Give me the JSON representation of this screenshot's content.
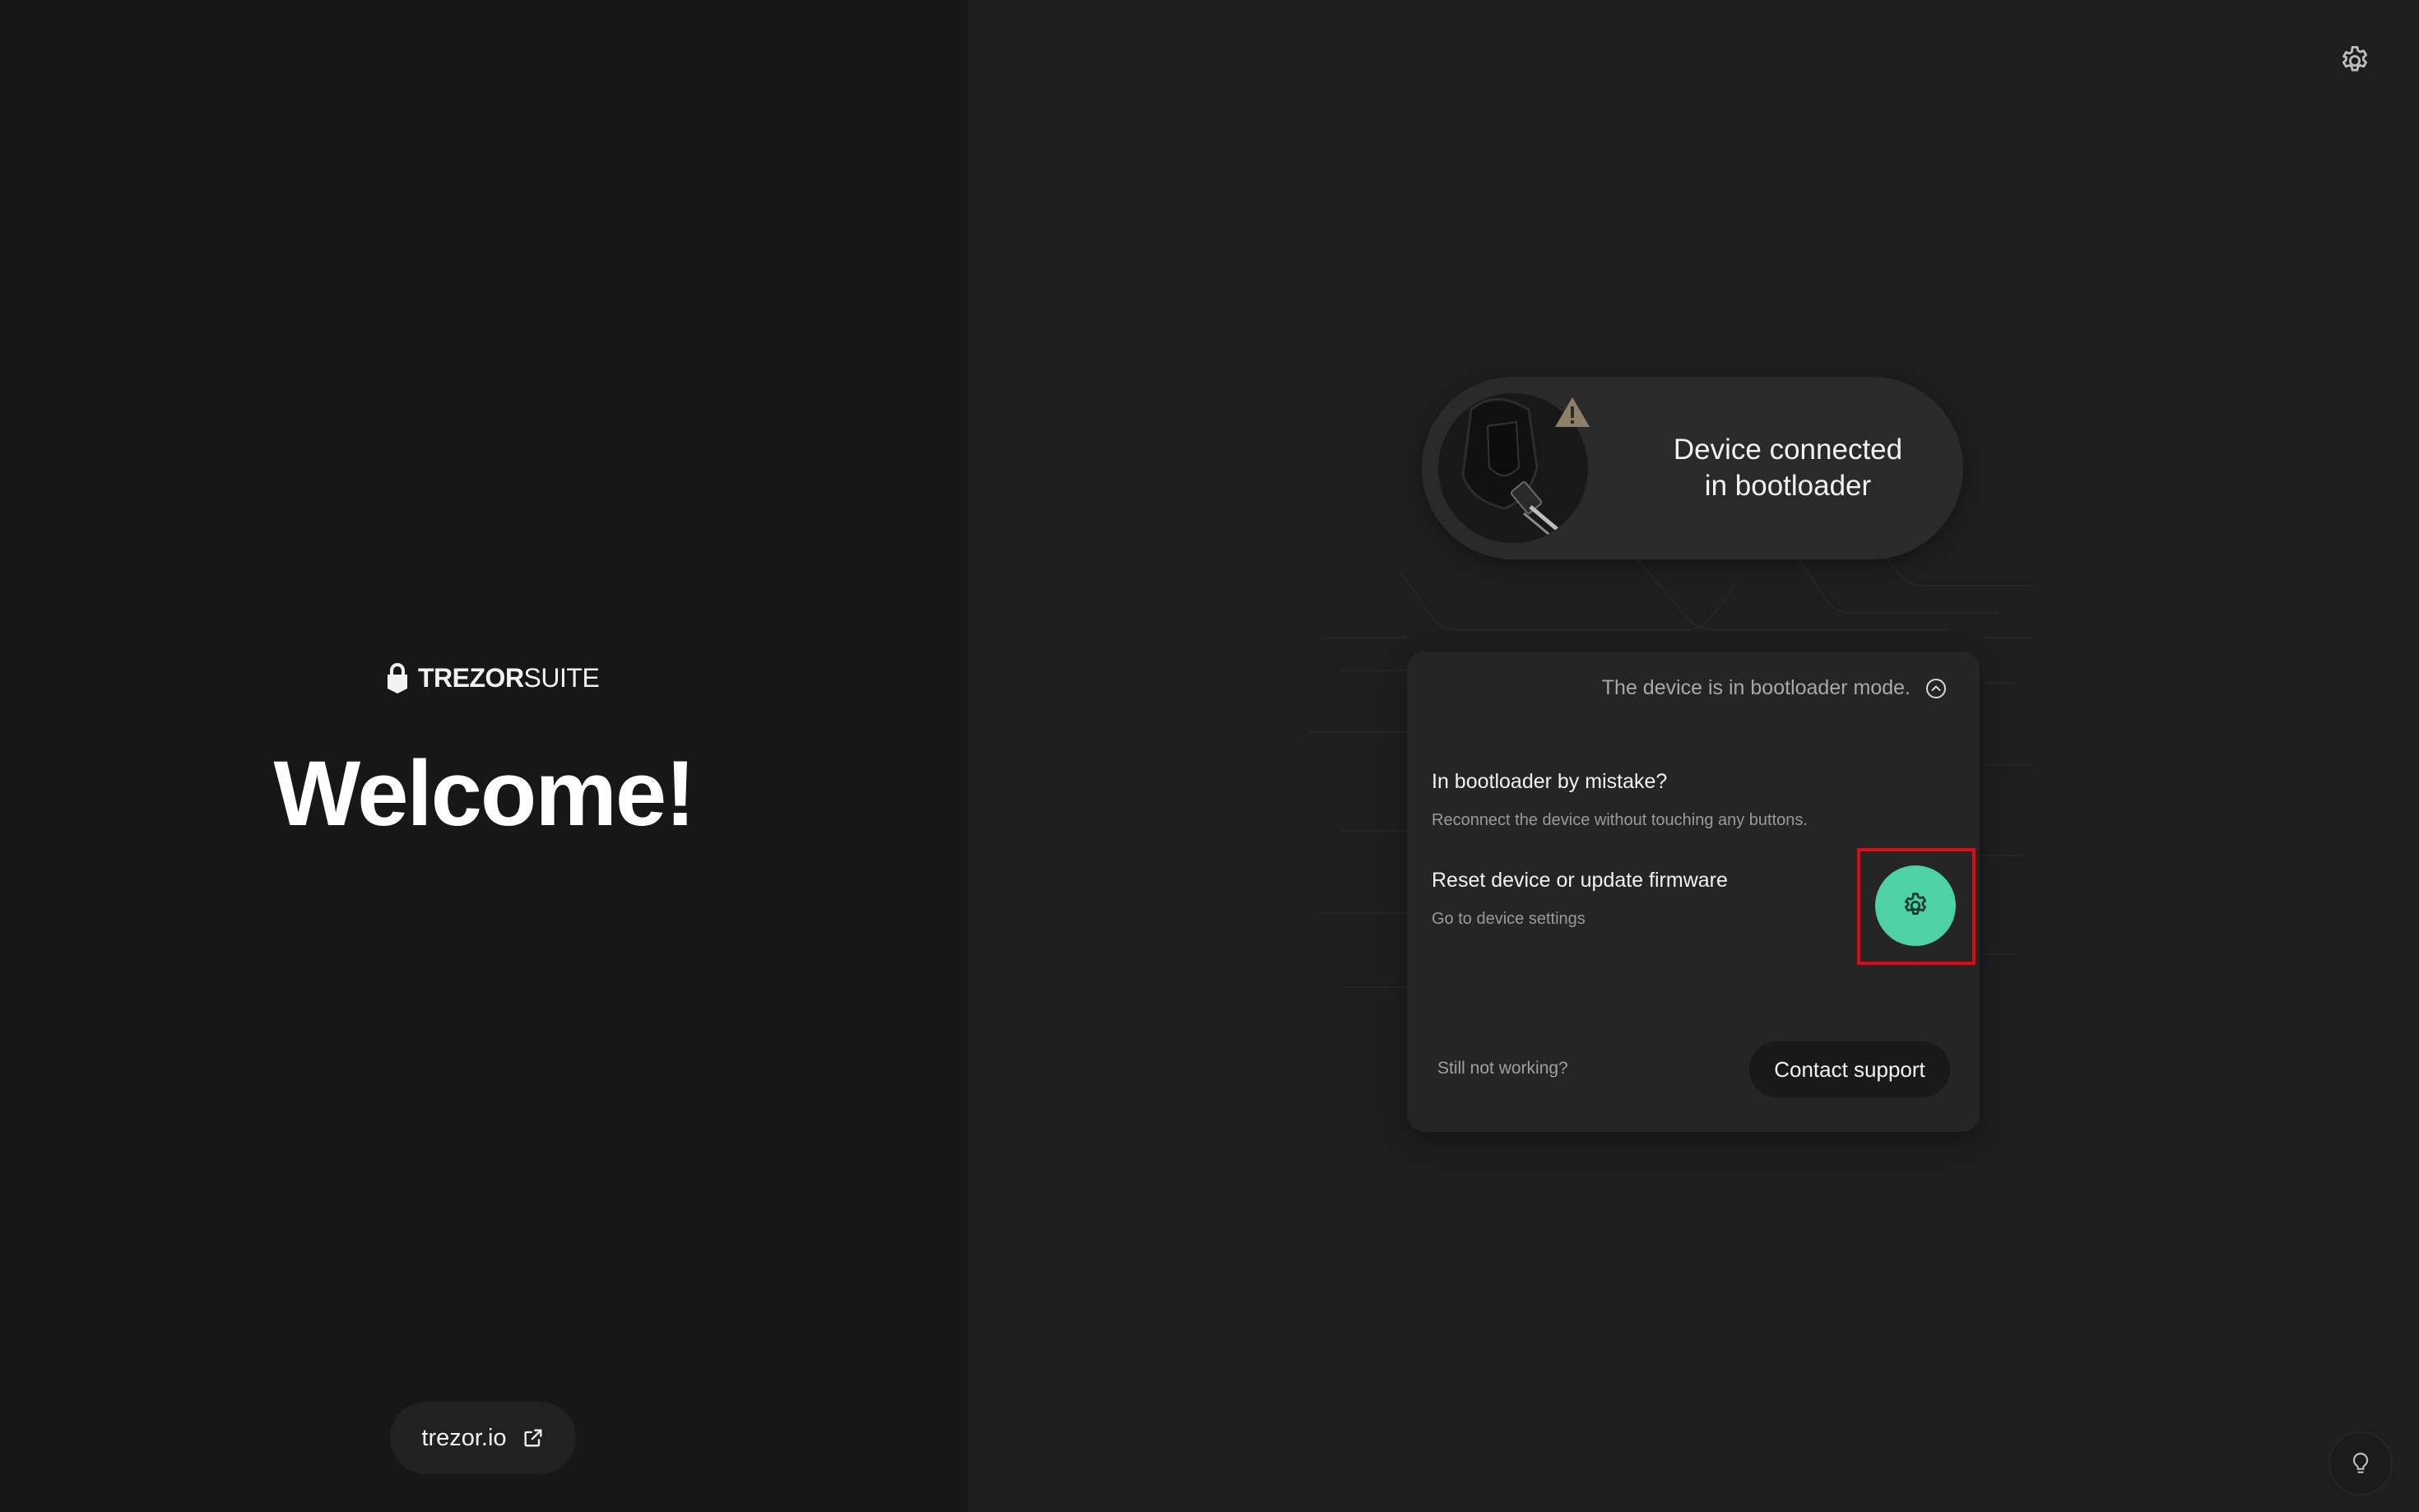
{
  "brand": {
    "logo_bold": "TREZOR",
    "logo_light": "SUITE",
    "welcome": "Welcome!",
    "link_label": "trezor.io",
    "link_icon": "external-link-icon"
  },
  "status": {
    "line1": "Device connected",
    "line2": "in bootloader",
    "warning_icon": "warning-icon"
  },
  "help_card": {
    "header": "The device is in bootloader mode.",
    "mistake_title": "In bootloader by mistake?",
    "mistake_desc": "Reconnect the device without touching any buttons.",
    "reset_title": "Reset device or update firmware",
    "reset_desc": "Go to device settings",
    "still_text": "Still not working?",
    "contact_label": "Contact support"
  },
  "colors": {
    "accent": "#4fd1a6",
    "highlight": "#e10a14",
    "left_bg": "#171717",
    "right_bg": "#1e1e1e"
  },
  "icons": {
    "top_settings": "gear-icon",
    "card_action": "gear-icon",
    "header_toggle": "chevron-up-icon",
    "tips": "lightbulb-icon"
  }
}
